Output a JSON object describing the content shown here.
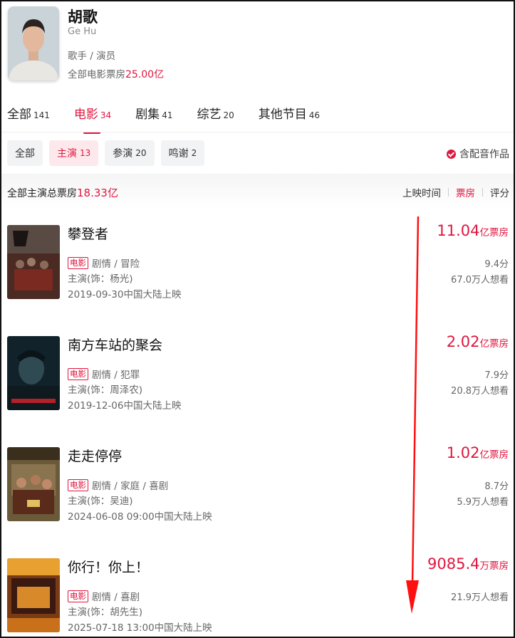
{
  "profile": {
    "name": "胡歌",
    "name_en": "Ge Hu",
    "roles": "歌手 / 演员",
    "total_box_label": "全部电影票房",
    "total_box_value": "25.00亿"
  },
  "category_tabs": [
    {
      "label": "全部",
      "count": "141",
      "active": false
    },
    {
      "label": "电影",
      "count": "34",
      "active": true
    },
    {
      "label": "剧集",
      "count": "41",
      "active": false
    },
    {
      "label": "综艺",
      "count": "20",
      "active": false
    },
    {
      "label": "其他节目",
      "count": "46",
      "active": false
    }
  ],
  "role_chips": [
    {
      "label": "全部",
      "count": "",
      "active": false
    },
    {
      "label": "主演",
      "count": "13",
      "active": true
    },
    {
      "label": "参演",
      "count": "20",
      "active": false
    },
    {
      "label": "鸣谢",
      "count": "2",
      "active": false
    }
  ],
  "dubbing_toggle": "含配音作品",
  "summary": {
    "label": "全部主演总票房",
    "value": "18.33亿"
  },
  "sort": [
    "上映时间",
    "票房",
    "评分"
  ],
  "sort_active": "票房",
  "movies": [
    {
      "title": "攀登者",
      "badge": "电影",
      "genres": "剧情 / 冒险",
      "role": "主演(饰：杨光)",
      "release": "2019-09-30中国大陆上映",
      "box_num": "11.04",
      "box_unit": "亿票房",
      "score": "9.4分",
      "want": "67.0万人想看"
    },
    {
      "title": "南方车站的聚会",
      "badge": "电影",
      "genres": "剧情 / 犯罪",
      "role": "主演(饰：周泽农)",
      "release": "2019-12-06中国大陆上映",
      "box_num": "2.02",
      "box_unit": "亿票房",
      "score": "7.9分",
      "want": "20.8万人想看"
    },
    {
      "title": "走走停停",
      "badge": "电影",
      "genres": "剧情 / 家庭 / 喜剧",
      "role": "主演(饰：吴迪)",
      "release": "2024-06-08 09:00中国大陆上映",
      "box_num": "1.02",
      "box_unit": "亿票房",
      "score": "8.7分",
      "want": "5.9万人想看"
    },
    {
      "title": "你行！你上！",
      "badge": "电影",
      "genres": "剧情 / 喜剧",
      "role": "主演(饰：胡先生)",
      "release": "2025-07-18 13:00中国大陆上映",
      "box_num": "9085.4",
      "box_unit": "万票房",
      "score": "",
      "want": "21.9万人想看"
    }
  ],
  "colors": {
    "accent": "#e0163e",
    "annotation_arrow": "#ff0000"
  }
}
